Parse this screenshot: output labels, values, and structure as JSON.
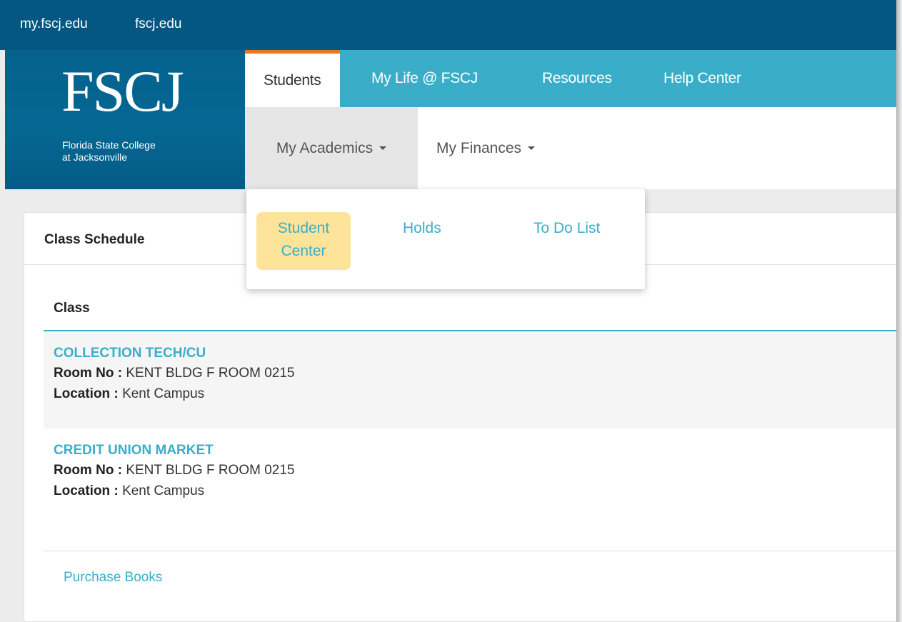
{
  "utility_links": [
    "my.fscj.edu",
    "fscj.edu"
  ],
  "logo": {
    "wordmark": "FSCJ",
    "line1": "Florida State College",
    "line2": "at Jacksonville"
  },
  "main_nav": [
    "Students",
    "My Life @ FSCJ",
    "Resources",
    "Help Center"
  ],
  "sub_nav": [
    "My Academics",
    "My Finances"
  ],
  "dropdown": [
    "Student Center",
    "Holds",
    "To Do List"
  ],
  "dropdown_hl_line1": "Student",
  "dropdown_hl_line2": "Center",
  "card": {
    "title": "Class Schedule",
    "column_header": "Class",
    "room_label": "Room No :",
    "location_label": "Location :",
    "classes": [
      {
        "name": "COLLECTION TECH/CU",
        "room": "KENT BLDG F ROOM 0215",
        "location": "Kent Campus"
      },
      {
        "name": "CREDIT UNION MARKET",
        "room": "KENT BLDG F ROOM 0215",
        "location": "Kent Campus"
      }
    ],
    "footer_link": "Purchase Books"
  },
  "colors": {
    "top_bar": "#035782",
    "nav": "#3aaec9",
    "accent": "#e97622",
    "highlight": "#fde49a"
  }
}
